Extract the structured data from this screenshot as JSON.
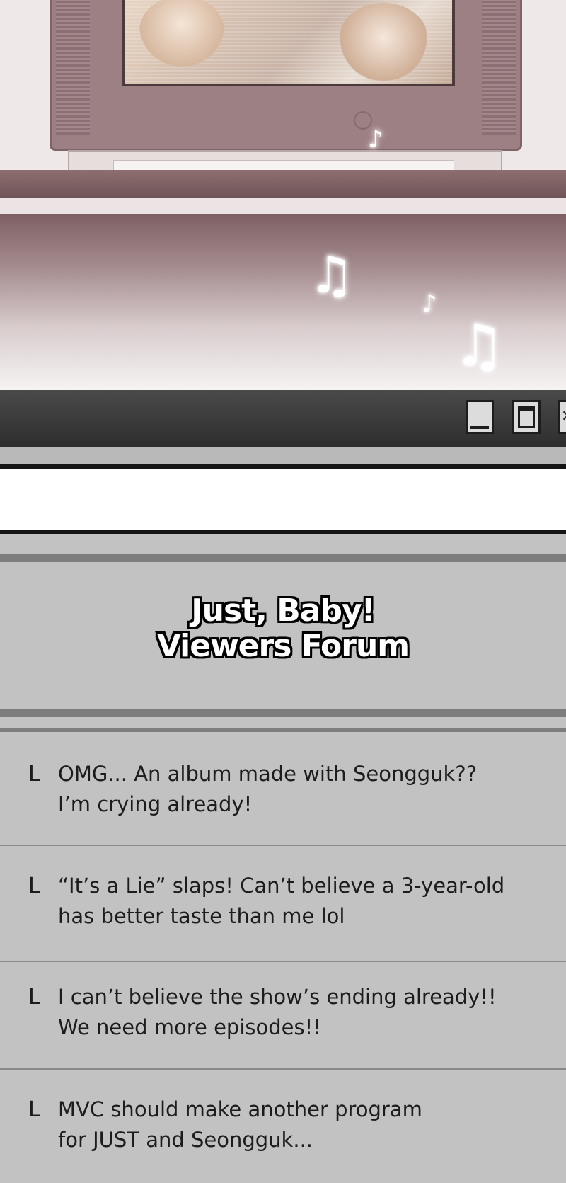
{
  "window": {
    "buttons": {
      "minimize_icon": "minimize-icon",
      "maximize_icon": "maximize-icon",
      "close_icon": "close-icon"
    }
  },
  "forum": {
    "title_line1": "Just, Baby!",
    "title_line2": "Viewers Forum",
    "reply_marker": "L",
    "comments": [
      {
        "lines": [
          "OMG... An album made with Seongguk??",
          "I’m crying already!"
        ]
      },
      {
        "lines": [
          "“It’s a Lie” slaps! Can’t believe a 3-year-old",
          "has better taste than me lol"
        ]
      },
      {
        "lines": [
          "I can’t believe the show’s ending already!!",
          "We need more episodes!!"
        ]
      },
      {
        "lines": [
          "MVC should make another program",
          "for JUST and Seongguk..."
        ]
      }
    ]
  },
  "scene": {
    "notes": [
      "♫",
      "♪",
      "♫",
      "♪"
    ]
  },
  "colors": {
    "forum_background": "#c2c2c2",
    "titlebar": "#3a3a3a",
    "title_text": "#ffffff",
    "title_outline": "#000000"
  }
}
